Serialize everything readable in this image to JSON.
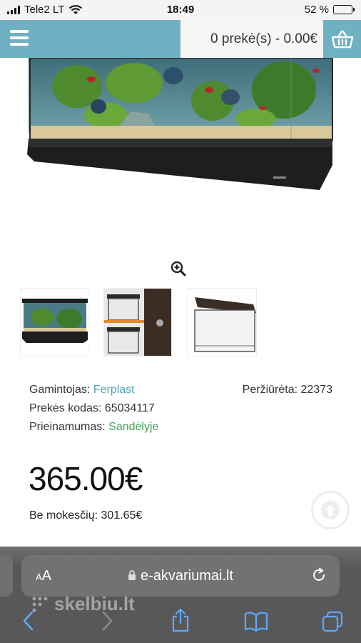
{
  "status_bar": {
    "carrier": "Tele2 LT",
    "time": "18:49",
    "battery_percent": "52 %",
    "battery_level": 0.52,
    "icons": [
      "signal-icon",
      "wifi-icon",
      "battery-icon"
    ]
  },
  "header": {
    "menu_icon": "hamburger-menu-icon",
    "cart_summary": "0 prekė(s) - 0.00€",
    "cart_icon": "basket-icon"
  },
  "gallery": {
    "main_image_alt": "aquarium",
    "zoom_icon": "zoom-in-icon",
    "thumbnails": [
      "aquarium-thumbnail",
      "aquarium-covers-thumbnail",
      "aquarium-tank-thumbnail"
    ]
  },
  "product": {
    "manufacturer_label": "Gamintojas:",
    "manufacturer_value": "Ferplast",
    "code_label": "Prekės kodas:",
    "code_value": "65034117",
    "availability_label": "Prieinamumas:",
    "availability_value": "Sandėlyje",
    "views_label": "Peržiūrėta:",
    "views_value": "22373",
    "price": "365.00€",
    "tax_label": "Be mokesčių:",
    "tax_value": "301.65€"
  },
  "browser": {
    "aa_small": "A",
    "aa_large": "A",
    "domain": "e-akvariumai.lt",
    "watermark": "skelbiu.lt"
  },
  "colors": {
    "header_accent": "#6fb1c2",
    "link": "#4fa6b7",
    "stock_green": "#43a553"
  }
}
